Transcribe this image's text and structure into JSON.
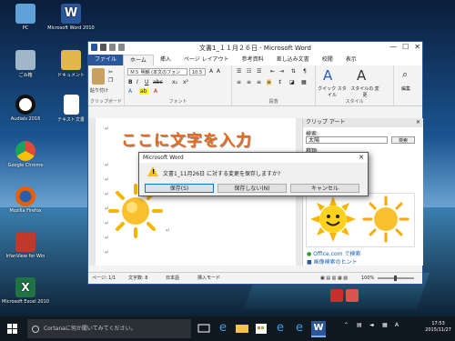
{
  "desktop": {
    "icons": [
      {
        "label": "PC",
        "color": "#5fa0d8"
      },
      {
        "label": "Microsoft Word 2010",
        "color": "#2b579a"
      },
      {
        "label": "ごみ箱",
        "color": "#9fb7c9"
      },
      {
        "label": "ドキュメント",
        "color": "#e2b74b"
      },
      {
        "label": "Audials 2016",
        "color": "#222222"
      },
      {
        "label": "テキスト文書",
        "color": "#ffffff"
      },
      {
        "label": "Google Chrome",
        "color": "#dd4b39"
      },
      {
        "label": "Mozilla Firefox",
        "color": "#e66000"
      },
      {
        "label": "IrfanView for Win",
        "color": "#c0392b"
      },
      {
        "label": "Microsoft Excel 2010",
        "color": "#217346"
      }
    ]
  },
  "word": {
    "title": "文書1_１１月２６日 - Microsoft Word",
    "window_controls": [
      "—",
      "☐",
      "✕"
    ],
    "tabs": [
      "ファイル",
      "ホーム",
      "挿入",
      "ページ レイアウト",
      "参考資料",
      "差し込み文書",
      "校閲",
      "表示"
    ],
    "active_tab": "ホーム",
    "ribbon": {
      "paste_label": "貼り付け",
      "clipboard_group": "クリップボード",
      "font_name": "ＭＳ 明朝 (本文のフォン",
      "font_size": "10.5",
      "font_group": "フォント",
      "paragraph_group": "段落",
      "quick_style": "クイック スタイル",
      "change_style": "スタイルの 変更",
      "styles_group": "スタイル",
      "edit_label": "編集"
    },
    "document": {
      "heading": "ここに文字を入力",
      "paragraph_mark": "↵"
    },
    "clipart": {
      "title": "クリップ アート",
      "search_label": "検索:",
      "search_value": "太陽",
      "search_button": "検索",
      "type_label": "種類:",
      "office_link": "Office.com で検索",
      "image_link": "画像検索のヒント"
    },
    "status": {
      "page": "ページ: 1/1",
      "words": "文字数: 8",
      "language": "日本語",
      "mode": "挿入モード",
      "zoom": "100%"
    }
  },
  "dialog": {
    "title": "Microsoft Word",
    "message": "文書1_11月26日 に対する変更を保存しますか?",
    "save": "保存(S)",
    "dont_save": "保存しない(N)",
    "cancel": "キャンセル"
  },
  "taskbar": {
    "search_placeholder": "Cortanaに何か聞いてみてください。",
    "time": "17:53",
    "date": "2015/11/27"
  },
  "colors": {
    "word_blue": "#2b579a",
    "heading_orange": "#e8691a",
    "sun": "#f8b400"
  }
}
